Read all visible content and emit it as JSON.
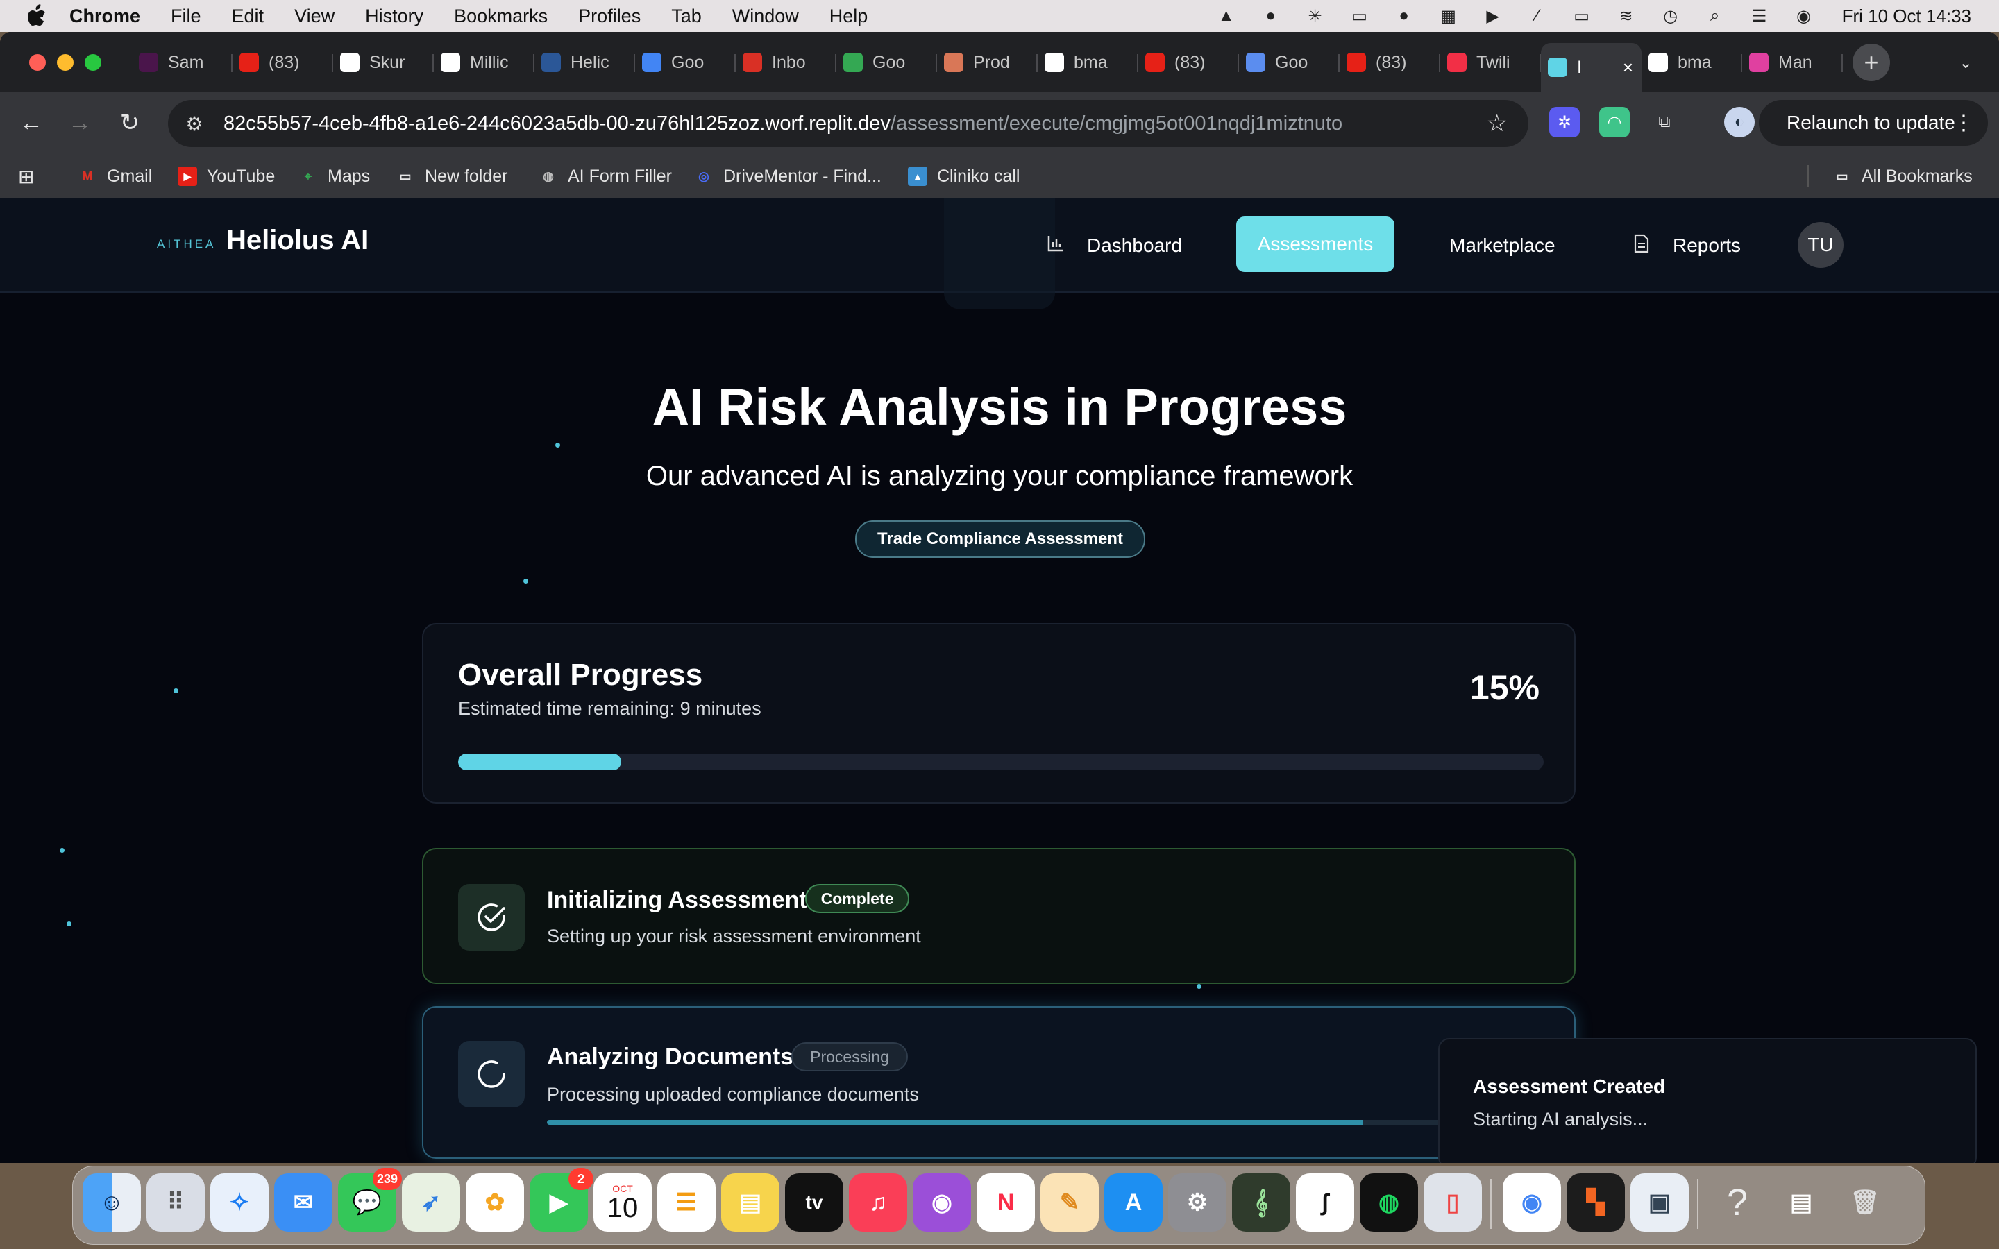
{
  "menubar": {
    "app": "Chrome",
    "items": [
      "File",
      "Edit",
      "View",
      "History",
      "Bookmarks",
      "Profiles",
      "Tab",
      "Window",
      "Help"
    ],
    "clock": "Fri 10 Oct  14:33"
  },
  "tabs": [
    {
      "label": "Sam",
      "icon": "slack-icon",
      "color": "#4a154b"
    },
    {
      "label": "(83)",
      "icon": "youtube-icon",
      "color": "#e62117"
    },
    {
      "label": "Skur",
      "icon": "app-icon",
      "color": "#ffffff"
    },
    {
      "label": "Millic",
      "icon": "app-icon",
      "color": "#ffffff"
    },
    {
      "label": "Helic",
      "icon": "word-icon",
      "color": "#2b5797"
    },
    {
      "label": "Goo",
      "icon": "docs-icon",
      "color": "#4285f4"
    },
    {
      "label": "Inbo",
      "icon": "gmail-icon",
      "color": "#d93025"
    },
    {
      "label": "Goo",
      "icon": "meet-icon",
      "color": "#34a853"
    },
    {
      "label": "Prod",
      "icon": "asterisk-icon",
      "color": "#d97757"
    },
    {
      "label": "bma",
      "icon": "github-icon",
      "color": "#ffffff"
    },
    {
      "label": "(83)",
      "icon": "youtube-icon",
      "color": "#e62117"
    },
    {
      "label": "Goo",
      "icon": "gemini-icon",
      "color": "#5b8def"
    },
    {
      "label": "(83)",
      "icon": "youtube-icon",
      "color": "#e62117"
    },
    {
      "label": "Twili",
      "icon": "twilio-icon",
      "color": "#f22f46"
    },
    {
      "label": "I",
      "icon": "replit-icon",
      "color": "#5fd4e6",
      "active": true
    },
    {
      "label": "bma",
      "icon": "google-icon",
      "color": "#ffffff"
    },
    {
      "label": "Man",
      "icon": "app-icon",
      "color": "#e040a0"
    }
  ],
  "address": {
    "host": "82c55b57-4ceb-4fb8-a1e6-244c6023a5db-00-zu76hl125zoz.worf.replit.dev",
    "path": "/assessment/execute/cmgjmg5ot001nqdj1miztnuto"
  },
  "relaunch_label": "Relaunch to update",
  "bookmarks": [
    {
      "label": "Gmail",
      "icon": "gmail-icon",
      "color": "#d93025"
    },
    {
      "label": "YouTube",
      "icon": "youtube-icon",
      "color": "#e62117"
    },
    {
      "label": "Maps",
      "icon": "maps-icon",
      "color": "#34a853"
    },
    {
      "label": "New folder",
      "icon": "folder-icon",
      "color": "#e6e6e6"
    },
    {
      "label": "AI Form Filler",
      "icon": "globe-icon",
      "color": "#bbbbbb"
    },
    {
      "label": "DriveMentor - Find...",
      "icon": "steering-icon",
      "color": "#4a6cf7"
    },
    {
      "label": "Cliniko call",
      "icon": "image-icon",
      "color": "#3a8fd0"
    }
  ],
  "all_bookmarks": "All Bookmarks",
  "app": {
    "brand_mark": "AITHEA",
    "brand": "Heliolus AI",
    "nav": {
      "dashboard": "Dashboard",
      "assessments": "Assessments",
      "marketplace": "Marketplace",
      "reports": "Reports",
      "avatar": "TU"
    }
  },
  "main": {
    "title": "AI Risk Analysis in Progress",
    "subtitle": "Our advanced AI is analyzing your compliance framework",
    "pill": "Trade Compliance Assessment"
  },
  "progress": {
    "title": "Overall Progress",
    "eta": "Estimated time remaining: 9 minutes",
    "percent_label": "15%",
    "percent": 15
  },
  "steps": [
    {
      "title": "Initializing Assessment",
      "status": "Complete",
      "desc": "Setting up your risk assessment environment"
    },
    {
      "title": "Analyzing Documents",
      "status": "Processing",
      "desc": "Processing uploaded compliance documents",
      "progress": 82
    }
  ],
  "toast": {
    "title": "Assessment Created",
    "desc": "Starting AI analysis..."
  },
  "dock": {
    "messages_badge": "239",
    "facetime_badge": "2",
    "calendar_month": "OCT",
    "calendar_day": "10",
    "appletv_label": "tv"
  },
  "colors": {
    "accent": "#6edfe9",
    "progress_fill": "#5fd4e6",
    "complete_border": "#2d5a32",
    "processing_border": "#2b5f79",
    "background": "#05070f"
  }
}
